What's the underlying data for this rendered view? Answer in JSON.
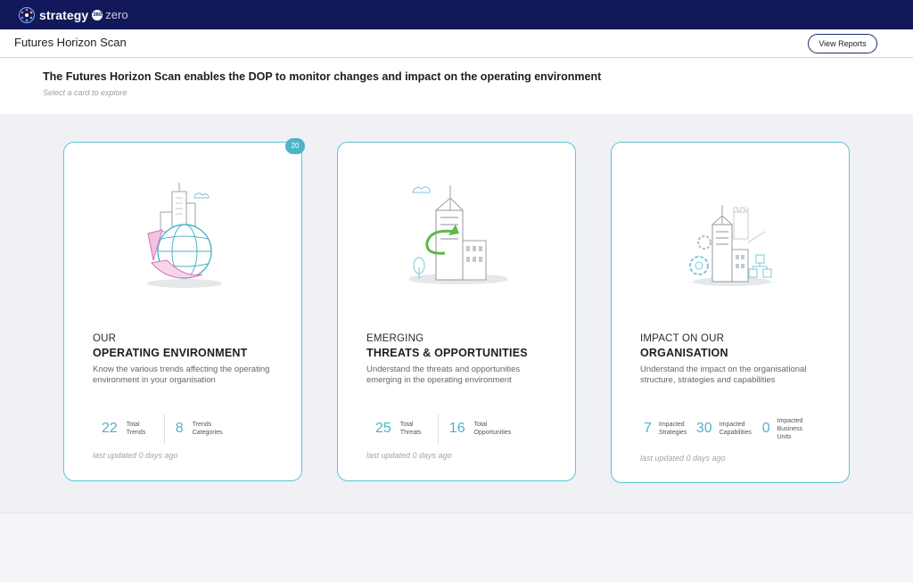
{
  "app": {
    "brand": "strategy",
    "brand_mark": "360",
    "brand_suffix": "zero"
  },
  "header": {
    "title": "Futures Horizon Scan",
    "view_reports_label": "View Reports"
  },
  "intro": {
    "headline": "The Futures Horizon Scan enables the DOP to monitor changes and impact on the operating environment",
    "subtext": "Select a card to explore"
  },
  "colors": {
    "navbar": "#13185a",
    "accent": "#4fb3c8",
    "card_border": "#5cc3d7"
  },
  "cards": [
    {
      "badge": "20",
      "kicker": "OUR",
      "heading": "OPERATING ENVIRONMENT",
      "description": "Know the various trends affecting the operating environment in your organisation",
      "illustration": "globe-city-icon",
      "stats": [
        {
          "value": "22",
          "label": "Total Trends"
        },
        {
          "value": "8",
          "label": "Trends Categories"
        }
      ],
      "updated": "last updated 0 days ago"
    },
    {
      "kicker": "EMERGING",
      "heading": "THREATS & OPPORTUNITIES",
      "description": "Understand the threats and opportunities emerging in the operating environment",
      "illustration": "city-arrow-icon",
      "stats": [
        {
          "value": "25",
          "label": "Total Threats"
        },
        {
          "value": "16",
          "label": "Total Opportunities"
        }
      ],
      "updated": "last updated 0 days ago"
    },
    {
      "kicker": "IMPACT ON OUR",
      "heading": "ORGANISATION",
      "description": "Understand the impact on the organisational structure, strategies and capabilities",
      "illustration": "org-gears-icon",
      "stats": [
        {
          "value": "7",
          "label": "Impacted Strategies"
        },
        {
          "value": "30",
          "label": "Impacted Capabilities"
        },
        {
          "value": "0",
          "label": "Impacted Business Units"
        }
      ],
      "updated": "last updated 0 days ago"
    }
  ]
}
